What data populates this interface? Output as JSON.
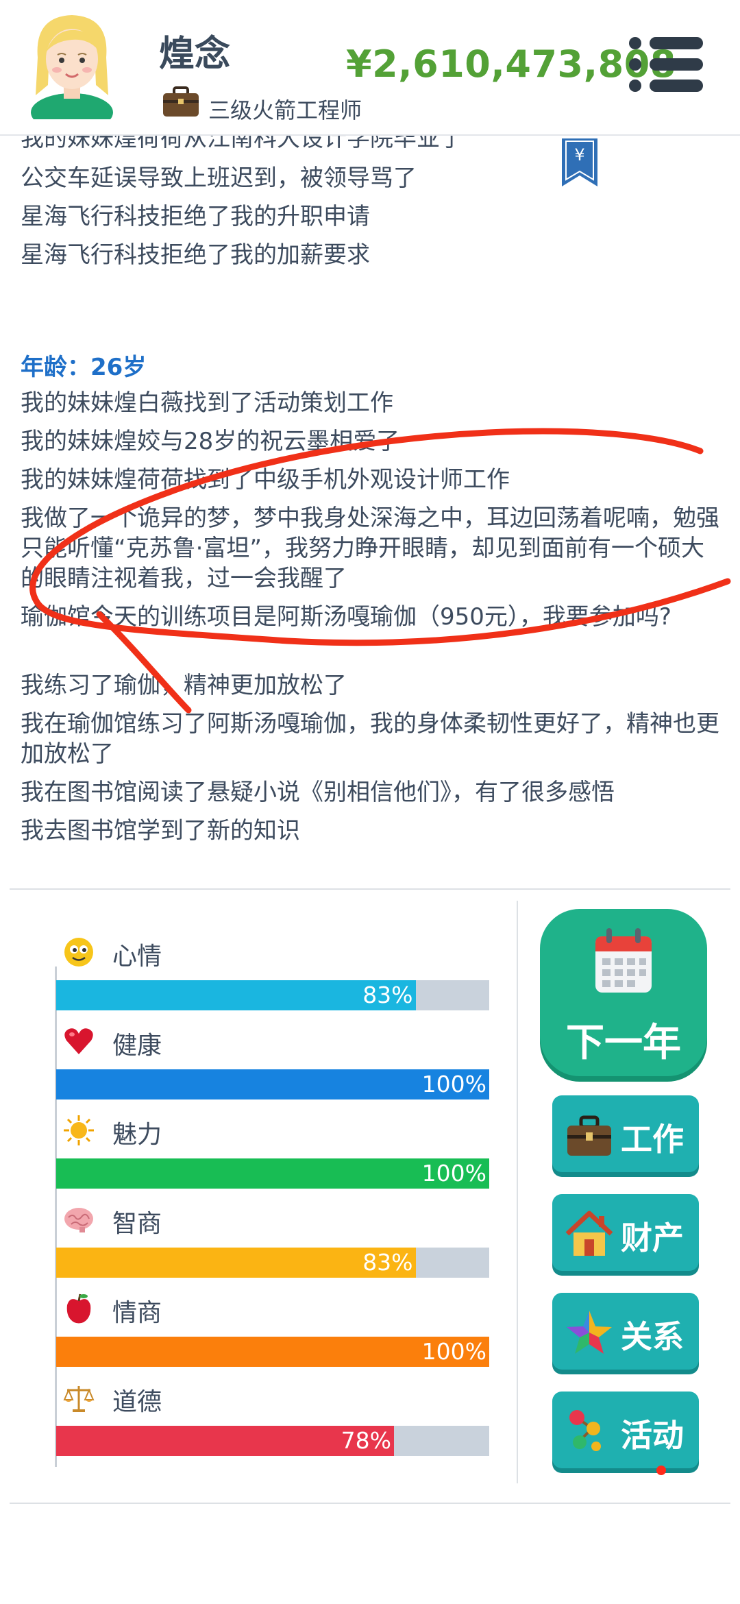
{
  "header": {
    "name": "煌念",
    "job_title": "三级火箭工程师",
    "money": "¥2,610,473,808"
  },
  "log": {
    "partial_top": "我的妹妹煌荷荷从江南科大设计学院毕业了",
    "prev_lines": [
      "公交车延误导致上班迟到，被领导骂了",
      "星海飞行科技拒绝了我的升职申请",
      "星海飞行科技拒绝了我的加薪要求"
    ],
    "age_heading": "年龄：26岁",
    "lines": [
      "我的妹妹煌白薇找到了活动策划工作",
      "我的妹妹煌姣与28岁的祝云墨相爱了",
      "我的妹妹煌荷荷找到了中级手机外观设计师工作",
      "我做了一个诡异的梦，梦中我身处深海之中，耳边回荡着呢喃，勉强只能听懂“克苏鲁·富坦”，我努力睁开眼睛，却见到面前有一个硕大的眼睛注视着我，过一会我醒了",
      "瑜伽馆今天的训练项目是阿斯汤嘎瑜伽（950元），我要参加吗?",
      "我练习了瑜伽，精神更加放松了",
      "我在瑜伽馆练习了阿斯汤嘎瑜伽，我的身体柔韧性更好了，精神也更加放松了",
      "我在图书馆阅读了悬疑小说《别相信他们》，有了很多感悟",
      "我去图书馆学到了新的知识"
    ]
  },
  "stats": [
    {
      "label": "心情",
      "icon": "smiley-icon",
      "value": 83,
      "pct": "83%",
      "color": "#1ab6e0"
    },
    {
      "label": "健康",
      "icon": "heart-icon",
      "value": 100,
      "pct": "100%",
      "color": "#1783e0"
    },
    {
      "label": "魅力",
      "icon": "sun-icon",
      "value": 100,
      "pct": "100%",
      "color": "#18bd54"
    },
    {
      "label": "智商",
      "icon": "brain-icon",
      "value": 83,
      "pct": "83%",
      "color": "#fbb413"
    },
    {
      "label": "情商",
      "icon": "apple-icon",
      "value": 100,
      "pct": "100%",
      "color": "#fb7f0c"
    },
    {
      "label": "道德",
      "icon": "scales-icon",
      "value": 78,
      "pct": "78%",
      "color": "#e8364c"
    }
  ],
  "actions": {
    "next_year": "下一年",
    "work": "工作",
    "assets": "财产",
    "relations": "关系",
    "activities": "活动"
  },
  "colors": {
    "money": "#53a136",
    "age_heading": "#1e6fc8",
    "next_button": "#1fb28a",
    "side_button": "#1fb0b0",
    "annotation": "#f03018"
  }
}
